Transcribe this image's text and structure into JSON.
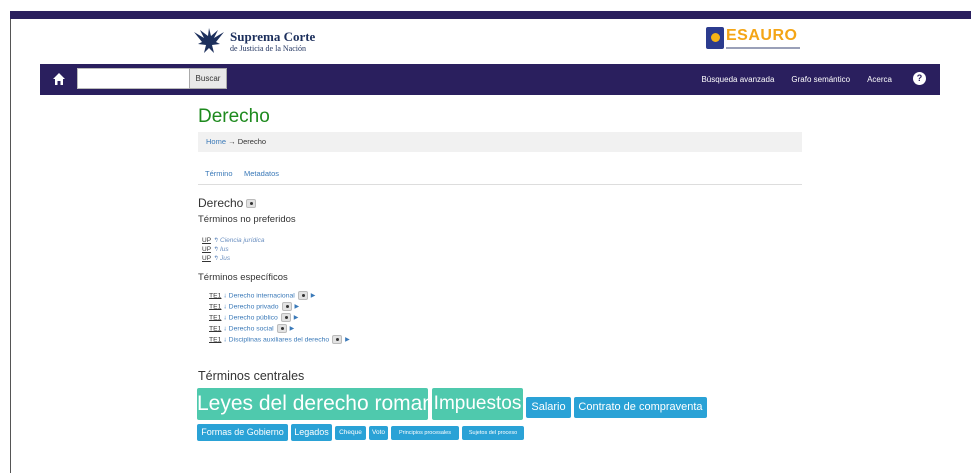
{
  "header": {
    "scjn_title": "Suprema Corte",
    "scjn_subtitle": "de Justicia de la Nación",
    "tesauro_word": "ESAURO"
  },
  "navbar": {
    "search_value": "",
    "search_button": "Buscar",
    "links": [
      "Búsqueda avanzada",
      "Grafo semántico",
      "Acerca"
    ],
    "help_label": "?"
  },
  "page": {
    "title": "Derecho",
    "breadcrumb": {
      "home": "Home",
      "sep": "→",
      "current": "Derecho"
    },
    "tabs": [
      "Término",
      "Metadatos"
    ],
    "term": "Derecho"
  },
  "non_preferred": {
    "heading": "Términos no preferidos",
    "items": [
      {
        "abbr": "UP",
        "arrow": "↰",
        "label": "Ciencia jurídica"
      },
      {
        "abbr": "UP",
        "arrow": "↰",
        "label": "Ius"
      },
      {
        "abbr": "UP",
        "arrow": "↰",
        "label": "Jus"
      }
    ]
  },
  "specific": {
    "heading": "Términos específicos",
    "items": [
      {
        "abbr": "TE1",
        "arrow": "↓",
        "label": "Derecho internacional"
      },
      {
        "abbr": "TE1",
        "arrow": "↓",
        "label": "Derecho privado"
      },
      {
        "abbr": "TE1",
        "arrow": "↓",
        "label": "Derecho público"
      },
      {
        "abbr": "TE1",
        "arrow": "↓",
        "label": "Derecho social"
      },
      {
        "abbr": "TE1",
        "arrow": "↓",
        "label": "Disciplinas auxiliares del derecho"
      }
    ]
  },
  "central": {
    "heading": "Términos centrales",
    "tags": [
      "Leyes del derecho romano",
      "Impuestos",
      "Salario",
      "Contrato de compraventa",
      "Formas de Gobierno",
      "Legados",
      "Cheque",
      "Voto",
      "Principios procesales",
      "Sujetos del proceso"
    ]
  },
  "colors": {
    "navbar": "#2a1f5e",
    "title_green": "#1e8a1e",
    "link_blue": "#3a79b8",
    "tag_teal": "#4fc9ad",
    "tag_blue": "#2aa2d6"
  }
}
